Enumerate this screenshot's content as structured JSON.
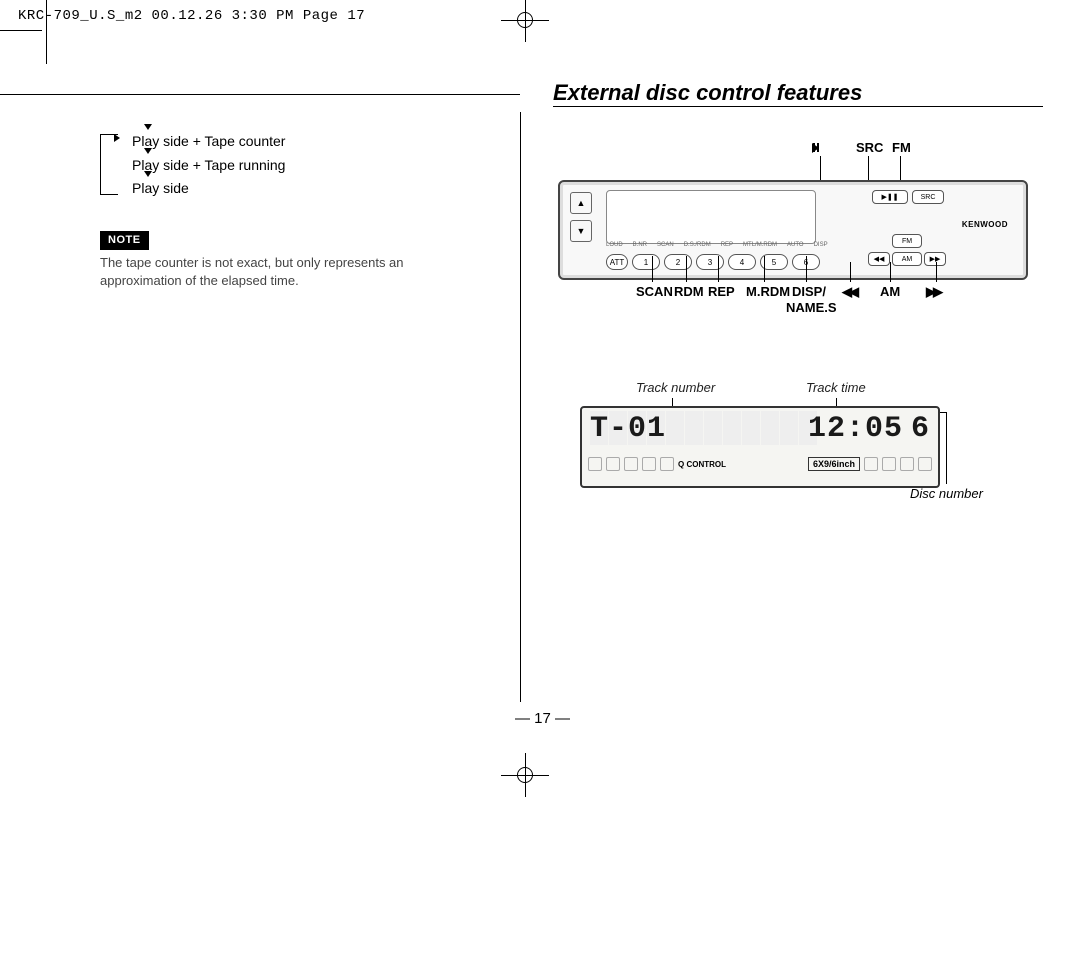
{
  "doc_header": "KRC-709_U.S_m2  00.12.26 3:30 PM  Page 17",
  "section_title": "External disc control features",
  "cycle": {
    "items": [
      "Play side + Tape counter",
      "Play side + Tape running",
      "Play side"
    ]
  },
  "note": {
    "badge": "NOTE",
    "text": "The tape counter is not exact, but only represents an approximation of the elapsed time."
  },
  "stereo": {
    "top_callouts": {
      "play_pause": "▶❚❚",
      "src": "SRC",
      "fm": "FM"
    },
    "bottom_callouts": {
      "scan": "SCAN",
      "rdm": "RDM",
      "rep": "REP",
      "mrdm": "M.RDM",
      "disp": "DISP/",
      "names": "NAME.S",
      "rew": "◀◀",
      "am": "AM",
      "fwd": "▶▶"
    },
    "preset_numbers": [
      "1",
      "2",
      "3",
      "4",
      "5",
      "6"
    ],
    "tiny_labels": [
      "LOUD",
      "B.NR",
      "SCAN",
      "D.S./RDM",
      "REP",
      "MTL/M.RDM",
      "AUTO",
      "DISP"
    ],
    "right_btns": {
      "play_src": "▶❚❚  SRC",
      "fm": "FM",
      "am": "AM"
    },
    "brand": "KENWOOD",
    "att": "ATT"
  },
  "display_panel": {
    "track_label": "Track number",
    "time_label": "Track time",
    "disc_label": "Disc number",
    "track_value": "T-01",
    "time_value": "12:05",
    "disc_value": "6",
    "speaker_badge": "6X9/6inch",
    "q_control": "Q CONTROL"
  },
  "page_number": "— 17 —"
}
